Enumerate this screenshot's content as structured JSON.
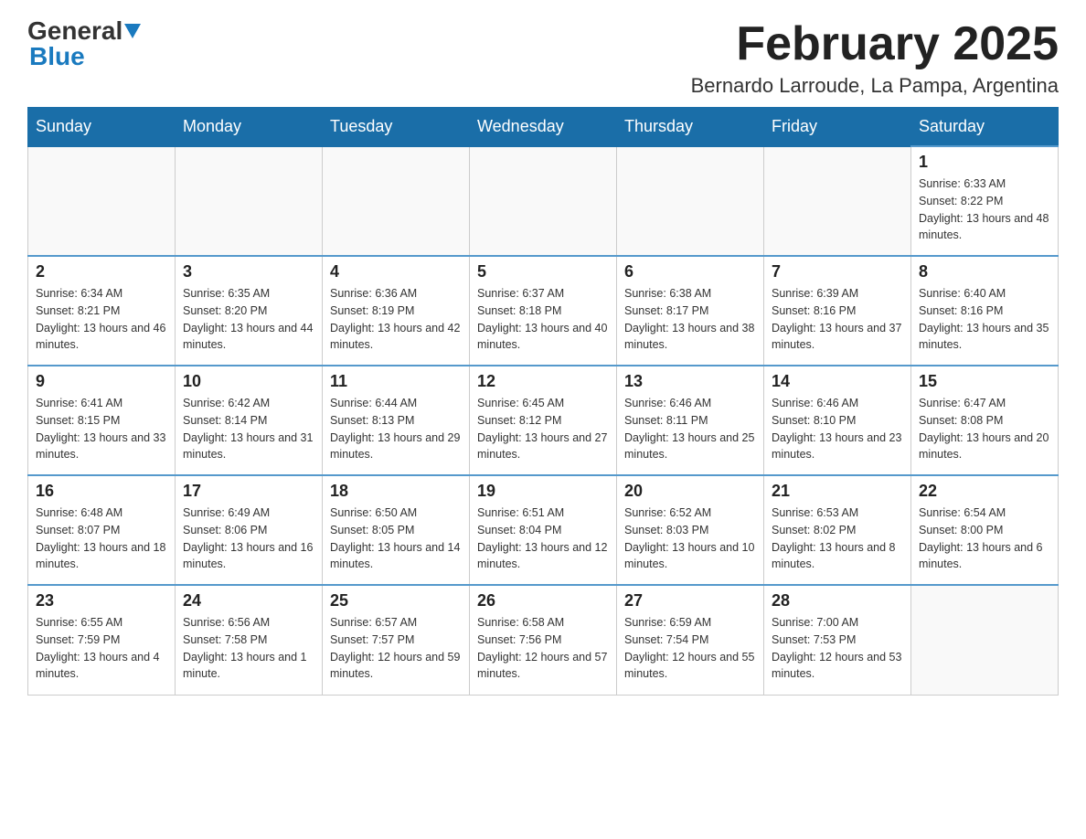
{
  "logo": {
    "general": "General",
    "blue": "Blue"
  },
  "header": {
    "title": "February 2025",
    "subtitle": "Bernardo Larroude, La Pampa, Argentina"
  },
  "weekdays": [
    "Sunday",
    "Monday",
    "Tuesday",
    "Wednesday",
    "Thursday",
    "Friday",
    "Saturday"
  ],
  "weeks": [
    [
      {
        "day": "",
        "info": ""
      },
      {
        "day": "",
        "info": ""
      },
      {
        "day": "",
        "info": ""
      },
      {
        "day": "",
        "info": ""
      },
      {
        "day": "",
        "info": ""
      },
      {
        "day": "",
        "info": ""
      },
      {
        "day": "1",
        "info": "Sunrise: 6:33 AM\nSunset: 8:22 PM\nDaylight: 13 hours and 48 minutes."
      }
    ],
    [
      {
        "day": "2",
        "info": "Sunrise: 6:34 AM\nSunset: 8:21 PM\nDaylight: 13 hours and 46 minutes."
      },
      {
        "day": "3",
        "info": "Sunrise: 6:35 AM\nSunset: 8:20 PM\nDaylight: 13 hours and 44 minutes."
      },
      {
        "day": "4",
        "info": "Sunrise: 6:36 AM\nSunset: 8:19 PM\nDaylight: 13 hours and 42 minutes."
      },
      {
        "day": "5",
        "info": "Sunrise: 6:37 AM\nSunset: 8:18 PM\nDaylight: 13 hours and 40 minutes."
      },
      {
        "day": "6",
        "info": "Sunrise: 6:38 AM\nSunset: 8:17 PM\nDaylight: 13 hours and 38 minutes."
      },
      {
        "day": "7",
        "info": "Sunrise: 6:39 AM\nSunset: 8:16 PM\nDaylight: 13 hours and 37 minutes."
      },
      {
        "day": "8",
        "info": "Sunrise: 6:40 AM\nSunset: 8:16 PM\nDaylight: 13 hours and 35 minutes."
      }
    ],
    [
      {
        "day": "9",
        "info": "Sunrise: 6:41 AM\nSunset: 8:15 PM\nDaylight: 13 hours and 33 minutes."
      },
      {
        "day": "10",
        "info": "Sunrise: 6:42 AM\nSunset: 8:14 PM\nDaylight: 13 hours and 31 minutes."
      },
      {
        "day": "11",
        "info": "Sunrise: 6:44 AM\nSunset: 8:13 PM\nDaylight: 13 hours and 29 minutes."
      },
      {
        "day": "12",
        "info": "Sunrise: 6:45 AM\nSunset: 8:12 PM\nDaylight: 13 hours and 27 minutes."
      },
      {
        "day": "13",
        "info": "Sunrise: 6:46 AM\nSunset: 8:11 PM\nDaylight: 13 hours and 25 minutes."
      },
      {
        "day": "14",
        "info": "Sunrise: 6:46 AM\nSunset: 8:10 PM\nDaylight: 13 hours and 23 minutes."
      },
      {
        "day": "15",
        "info": "Sunrise: 6:47 AM\nSunset: 8:08 PM\nDaylight: 13 hours and 20 minutes."
      }
    ],
    [
      {
        "day": "16",
        "info": "Sunrise: 6:48 AM\nSunset: 8:07 PM\nDaylight: 13 hours and 18 minutes."
      },
      {
        "day": "17",
        "info": "Sunrise: 6:49 AM\nSunset: 8:06 PM\nDaylight: 13 hours and 16 minutes."
      },
      {
        "day": "18",
        "info": "Sunrise: 6:50 AM\nSunset: 8:05 PM\nDaylight: 13 hours and 14 minutes."
      },
      {
        "day": "19",
        "info": "Sunrise: 6:51 AM\nSunset: 8:04 PM\nDaylight: 13 hours and 12 minutes."
      },
      {
        "day": "20",
        "info": "Sunrise: 6:52 AM\nSunset: 8:03 PM\nDaylight: 13 hours and 10 minutes."
      },
      {
        "day": "21",
        "info": "Sunrise: 6:53 AM\nSunset: 8:02 PM\nDaylight: 13 hours and 8 minutes."
      },
      {
        "day": "22",
        "info": "Sunrise: 6:54 AM\nSunset: 8:00 PM\nDaylight: 13 hours and 6 minutes."
      }
    ],
    [
      {
        "day": "23",
        "info": "Sunrise: 6:55 AM\nSunset: 7:59 PM\nDaylight: 13 hours and 4 minutes."
      },
      {
        "day": "24",
        "info": "Sunrise: 6:56 AM\nSunset: 7:58 PM\nDaylight: 13 hours and 1 minute."
      },
      {
        "day": "25",
        "info": "Sunrise: 6:57 AM\nSunset: 7:57 PM\nDaylight: 12 hours and 59 minutes."
      },
      {
        "day": "26",
        "info": "Sunrise: 6:58 AM\nSunset: 7:56 PM\nDaylight: 12 hours and 57 minutes."
      },
      {
        "day": "27",
        "info": "Sunrise: 6:59 AM\nSunset: 7:54 PM\nDaylight: 12 hours and 55 minutes."
      },
      {
        "day": "28",
        "info": "Sunrise: 7:00 AM\nSunset: 7:53 PM\nDaylight: 12 hours and 53 minutes."
      },
      {
        "day": "",
        "info": ""
      }
    ]
  ]
}
